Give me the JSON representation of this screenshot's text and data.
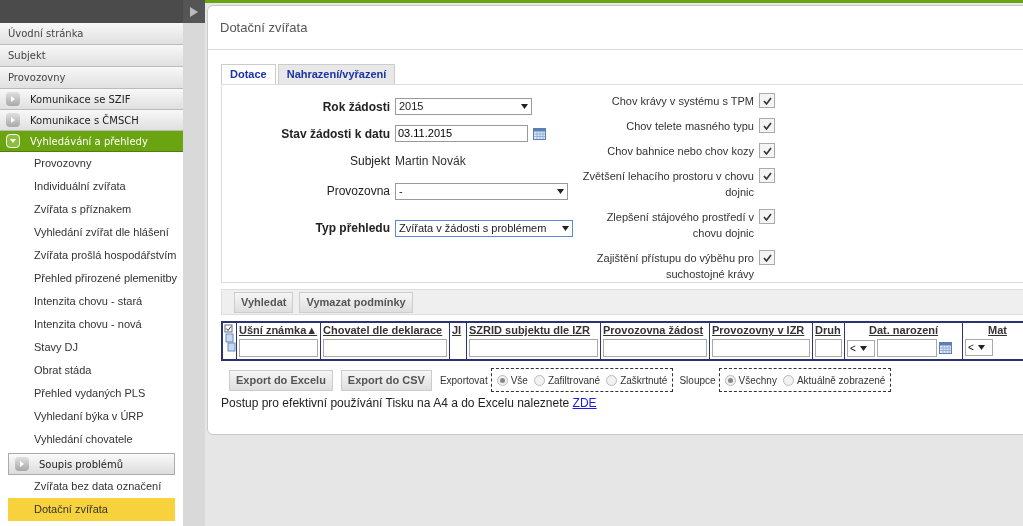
{
  "sidebar": {
    "items": [
      {
        "label": "Úvodní stránka",
        "kind": "link"
      },
      {
        "label": "Subjekt",
        "kind": "link"
      },
      {
        "label": "Provozovny",
        "kind": "link"
      },
      {
        "label": "Komunikace se SZIF",
        "kind": "group",
        "expanded": false
      },
      {
        "label": "Komunikace s ČMSCH",
        "kind": "group",
        "expanded": false
      },
      {
        "label": "Vyhledávání a přehledy",
        "kind": "group",
        "expanded": true,
        "children": [
          {
            "label": "Provozovny",
            "kind": "item",
            "selected": false
          },
          {
            "label": "Individuální zvířata",
            "kind": "item",
            "selected": false
          },
          {
            "label": "Zvířata s příznakem",
            "kind": "item",
            "selected": false
          },
          {
            "label": "Vyhledání zvířat dle hlášení",
            "kind": "item",
            "selected": false
          },
          {
            "label": "Zvířata prošlá hospodářstvím",
            "kind": "item",
            "selected": false
          },
          {
            "label": "Přehled přirozené plemenitby",
            "kind": "item",
            "selected": false
          },
          {
            "label": "Intenzita chovu - stará",
            "kind": "item",
            "selected": false
          },
          {
            "label": "Intenzita chovu - nová",
            "kind": "item",
            "selected": false
          },
          {
            "label": "Stavy DJ",
            "kind": "item",
            "selected": false
          },
          {
            "label": "Obrat stáda",
            "kind": "item",
            "selected": false
          },
          {
            "label": "Přehled vydaných PLS",
            "kind": "item",
            "selected": false
          },
          {
            "label": "Vyhledaní býka v ÚRP",
            "kind": "item",
            "selected": false
          },
          {
            "label": "Vyhledání chovatele",
            "kind": "item",
            "selected": false
          },
          {
            "label": "Soupis problémů",
            "kind": "subgroup",
            "children": [
              {
                "label": "Zvířata bez data označení",
                "kind": "item",
                "selected": false
              },
              {
                "label": "Dotační zvířata",
                "kind": "item",
                "selected": true
              }
            ]
          }
        ]
      }
    ]
  },
  "page": {
    "title": "Dotační zvířata"
  },
  "tabs": [
    {
      "label": "Dotace",
      "selected": true
    },
    {
      "label": "Nahrazení/vyřazení",
      "selected": false
    }
  ],
  "form": {
    "fields": [
      {
        "label": "Rok žádosti",
        "bold": true,
        "kind": "select",
        "value": "2015"
      },
      {
        "label": "Stav žádosti k datu",
        "bold": true,
        "kind": "date",
        "value": "03.11.2015"
      },
      {
        "label": "Subjekt",
        "bold": false,
        "kind": "static",
        "value": "Martin Novák"
      },
      {
        "label": "Provozovna",
        "bold": false,
        "kind": "select",
        "value": "-"
      },
      {
        "label": "Typ přehledu",
        "bold": true,
        "kind": "select",
        "value": "Zvířata v žádosti s problémem"
      }
    ],
    "checkboxes": [
      {
        "label": "Chov krávy v systému s TPM",
        "checked": true
      },
      {
        "label": "Chov telete masného typu",
        "checked": true
      },
      {
        "label": "Chov bahnice nebo chov kozy",
        "checked": true
      },
      {
        "label": "Zvětšení lehacího prostoru v chovu dojnic",
        "checked": true
      },
      {
        "label": "Zlepšení stájového prostředí v chovu dojnic",
        "checked": true
      },
      {
        "label": "Zajištění přístupu do výběhu pro suchostojné krávy",
        "checked": true
      }
    ]
  },
  "search_buttons": [
    "Vyhledat",
    "Vymazat podmínky"
  ],
  "grid": {
    "columns": [
      {
        "label": "Ušní známka▲",
        "kind": "text"
      },
      {
        "label": "Chovatel dle deklarace",
        "kind": "text"
      },
      {
        "label": "JI",
        "kind": "plain"
      },
      {
        "label": "SZRID subjektu dle IZR",
        "kind": "text"
      },
      {
        "label": "Provozovna žádost",
        "kind": "text"
      },
      {
        "label": "Provozovny v IZR",
        "kind": "text"
      },
      {
        "label": "Druh",
        "kind": "text"
      },
      {
        "label": "Dat. narození",
        "kind": "date",
        "operator": "<"
      },
      {
        "label": "Mat",
        "kind": "compare",
        "operator": "<"
      }
    ]
  },
  "export": {
    "buttons": [
      "Export do Excelu",
      "Export do CSV"
    ],
    "groups": [
      {
        "label": "Exportovat",
        "options": [
          {
            "label": "Vše",
            "selected": true
          },
          {
            "label": "Zafiltrované",
            "selected": false
          },
          {
            "label": "Zaškrtnuté",
            "selected": false
          }
        ]
      },
      {
        "label": "Sloupce",
        "options": [
          {
            "label": "Všechny",
            "selected": true
          },
          {
            "label": "Aktuálně zobrazené",
            "selected": false
          }
        ]
      }
    ],
    "note": "Postup pro efektivní používání Tisku na A4 a do Excelu naleznete",
    "link": "ZDE"
  }
}
